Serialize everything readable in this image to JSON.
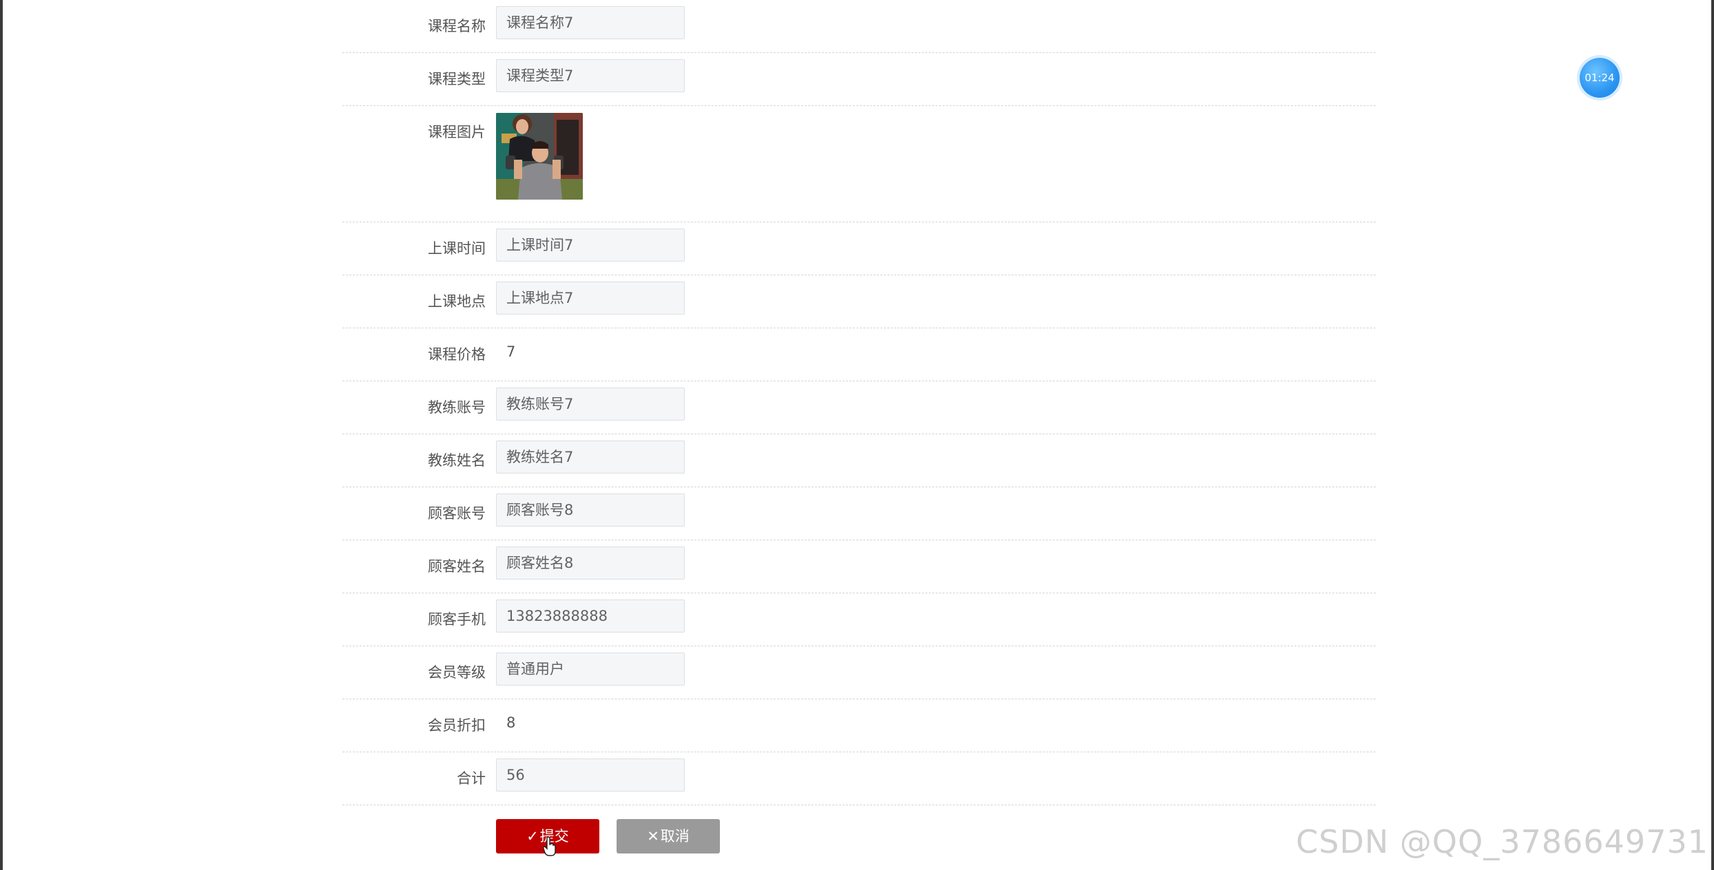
{
  "form": {
    "fields": [
      {
        "label": "课程名称",
        "value": "课程名称7"
      },
      {
        "label": "课程类型",
        "value": "课程类型7"
      },
      {
        "label": "课程图片"
      },
      {
        "label": "上课时间",
        "value": "上课时间7"
      },
      {
        "label": "上课地点",
        "value": "上课地点7"
      },
      {
        "label": "课程价格",
        "value": "7"
      },
      {
        "label": "教练账号",
        "value": "教练账号7"
      },
      {
        "label": "教练姓名",
        "value": "教练姓名7"
      },
      {
        "label": "顾客账号",
        "value": "顾客账号8"
      },
      {
        "label": "顾客姓名",
        "value": "顾客姓名8"
      },
      {
        "label": "顾客手机",
        "value": "13823888888"
      },
      {
        "label": "会员等级",
        "value": "普通用户"
      },
      {
        "label": "会员折扣",
        "value": "8"
      },
      {
        "label": "合计",
        "value": "56"
      }
    ]
  },
  "buttons": {
    "submit_icon": "✓",
    "submit_label": "提交",
    "cancel_icon": "✕",
    "cancel_label": "取消"
  },
  "timer": "01:24",
  "watermark": "CSDN @QQ_3786649731",
  "icons": {
    "submit": "check-icon",
    "cancel": "close-icon",
    "cursor": "hand-pointer-icon"
  },
  "colors": {
    "submit": "#c00000",
    "cancel": "#9a9a9a",
    "timer": "#2b95f2"
  }
}
